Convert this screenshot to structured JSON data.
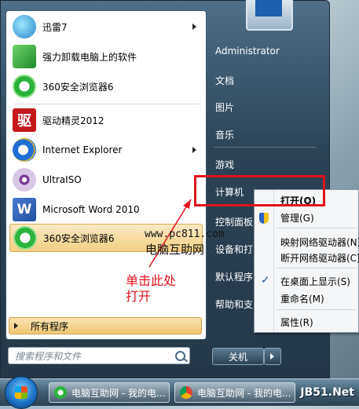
{
  "start_menu": {
    "programs": [
      {
        "label": "迅雷7",
        "icon": "thunder-icon",
        "has_submenu": true
      },
      {
        "label": "强力卸载电脑上的软件",
        "icon": "uninstall-icon",
        "has_submenu": false
      },
      {
        "label": "360安全浏览器6",
        "icon": "360-browser-icon",
        "has_submenu": false
      },
      {
        "label": "驱动精灵2012",
        "icon": "driver-genius-icon",
        "icon_text": "驱",
        "has_submenu": false
      },
      {
        "label": "Internet Explorer",
        "icon": "ie-icon",
        "has_submenu": true
      },
      {
        "label": "UltraISO",
        "icon": "ultraiso-icon",
        "has_submenu": false
      },
      {
        "label": "Microsoft Word 2010",
        "icon": "word-icon",
        "icon_text": "W",
        "has_submenu": false
      },
      {
        "label": "360安全浏览器6",
        "icon": "360-browser-icon",
        "has_submenu": false,
        "selected": true
      }
    ],
    "all_programs": "所有程序",
    "search_placeholder": "搜索程序和文件",
    "right_links": {
      "user": "Administrator",
      "documents": "文档",
      "pictures": "图片",
      "music": "音乐",
      "games": "游戏",
      "computer": "计算机",
      "control_panel": "控制面板",
      "devices": "设备和打",
      "default_programs": "默认程序",
      "help": "帮助和支"
    },
    "shutdown": "关机"
  },
  "context_menu": {
    "open": "打开(O)",
    "manage": "管理(G)",
    "map_drive": "映射网络驱动器(N)",
    "disconnect_drive": "断开网络驱动器(C)",
    "show_on_desktop": "在桌面上显示(S)",
    "rename": "重命名(M)",
    "properties": "属性(R)"
  },
  "annotation": {
    "watermark_url": "www.pc811.com",
    "watermark_name": "电脑互助网",
    "instruction_line1": "单击此处",
    "instruction_line2": "打开",
    "highlight_color": "#e0121b"
  },
  "taskbar": {
    "tasks": [
      {
        "label": "电脑互助网 - 我的电...",
        "icon": "360-browser-icon"
      },
      {
        "label": "电脑互助网 - 我的电...",
        "icon": "chrome-icon"
      }
    ],
    "corner_watermark": "JB51.Net"
  }
}
